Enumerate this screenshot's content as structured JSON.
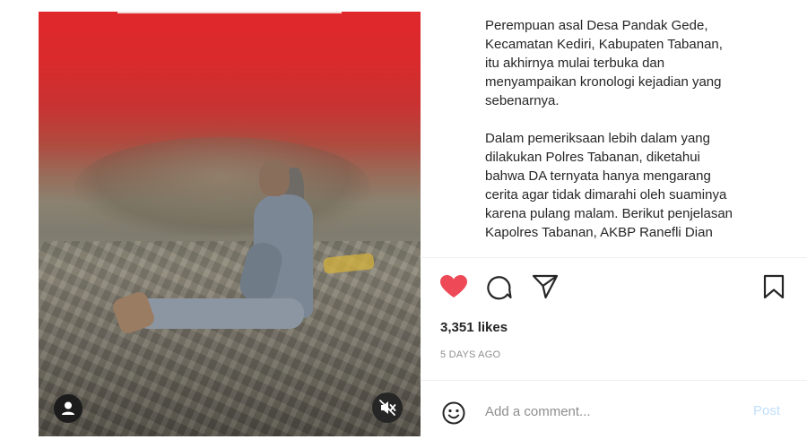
{
  "media": {
    "type": "video",
    "user_tag_icon": "person-icon",
    "mute_icon": "speaker-muted-icon"
  },
  "caption": {
    "paragraphs": [
      "Perempuan asal Desa Pandak Gede,\nKecamatan Kediri, Kabupaten Tabanan,\nitu akhirnya mulai terbuka dan\nmenyampaikan kronologi kejadian yang\nsebenarnya.",
      "Dalam pemeriksaan lebih dalam yang\ndilakukan Polres Tabanan, diketahui\nbahwa DA ternyata hanya mengarang\ncerita agar tidak dimarahi oleh suaminya\nkarena pulang malam. Berikut penjelasan\nKapolres Tabanan, AKBP Ranefli Dian"
    ]
  },
  "actions": {
    "like_icon": "heart-filled-icon",
    "like_color": "#ed4956",
    "comment_icon": "speech-bubble-icon",
    "share_icon": "paper-plane-icon",
    "save_icon": "bookmark-icon"
  },
  "likes_text": "3,351 likes",
  "time_text": "5 DAYS AGO",
  "comment": {
    "emoji_icon": "smiley-icon",
    "placeholder": "Add a comment...",
    "post_label": "Post",
    "post_color": "#c0dffd"
  }
}
